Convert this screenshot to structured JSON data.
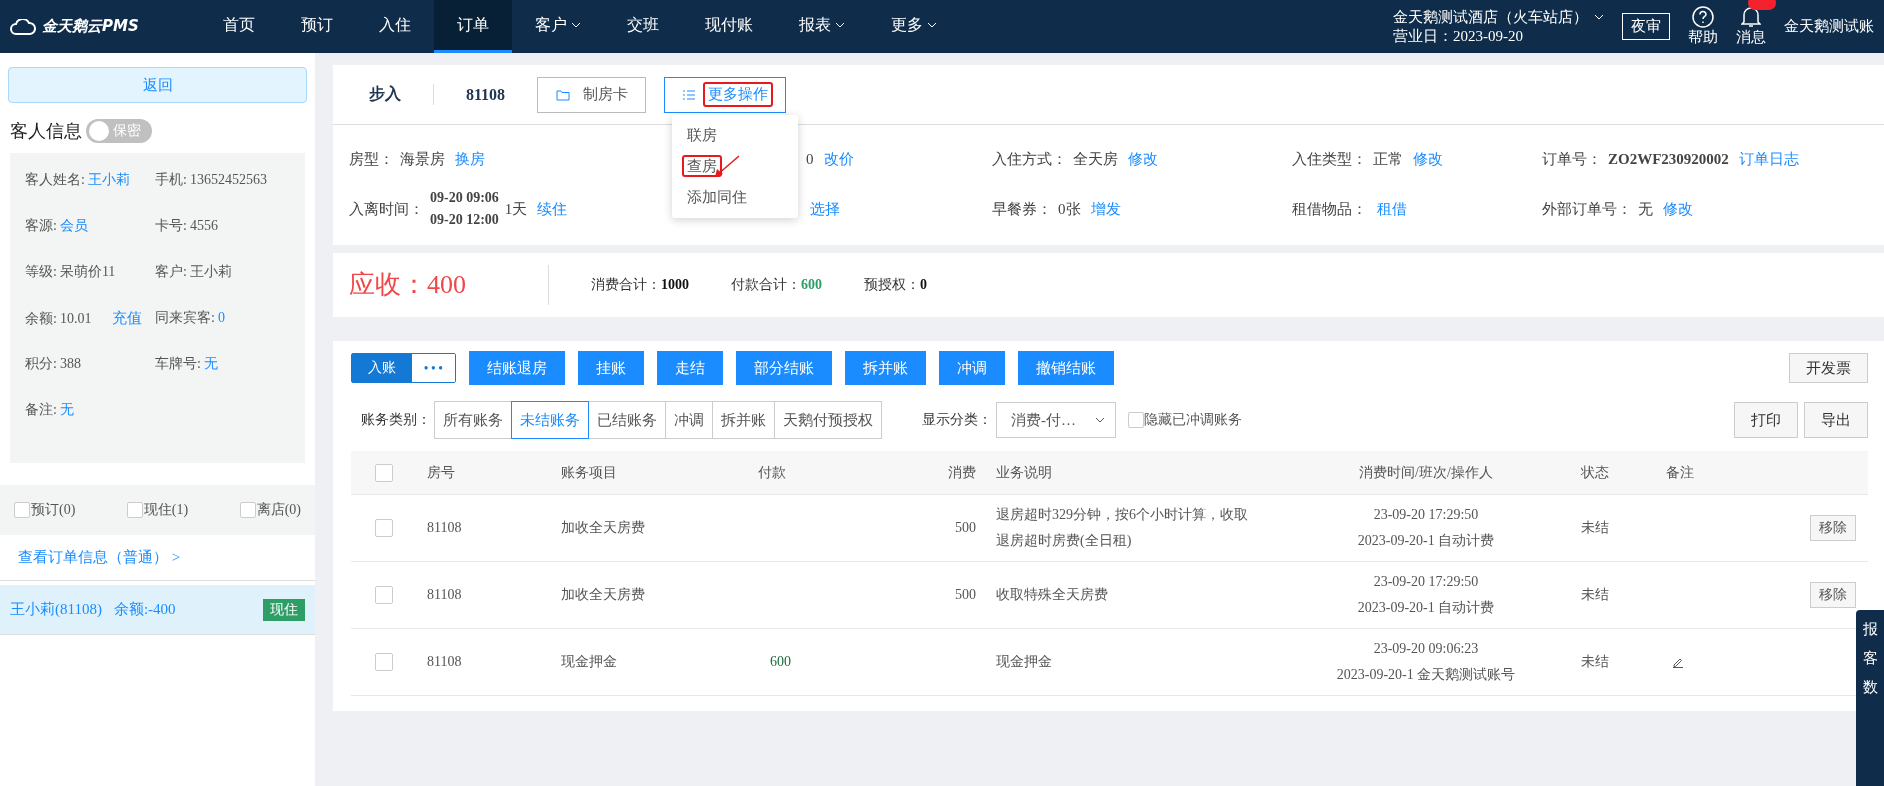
{
  "topbar": {
    "logo": "金天鹅云PMS",
    "nav": [
      {
        "label": "首页",
        "selected": false,
        "caret": false
      },
      {
        "label": "预订",
        "selected": false,
        "caret": false
      },
      {
        "label": "入住",
        "selected": false,
        "caret": false
      },
      {
        "label": "订单",
        "selected": true,
        "caret": false
      },
      {
        "label": "客户",
        "selected": false,
        "caret": true
      },
      {
        "label": "交班",
        "selected": false,
        "caret": false
      },
      {
        "label": "现付账",
        "selected": false,
        "caret": false
      },
      {
        "label": "报表",
        "selected": false,
        "caret": true
      },
      {
        "label": "更多",
        "selected": false,
        "caret": true
      }
    ],
    "hotel": "金天鹅测试酒店（火车站店）",
    "business_day": "营业日：2023-09-20",
    "night_audit": "夜审",
    "help": "帮助",
    "messages": "消息",
    "account": "金天鹅测试账"
  },
  "sidebar": {
    "back": "返回",
    "guest_title": "客人信息",
    "privacy": {
      "label": "保密",
      "on": false
    },
    "guest_fields": [
      {
        "label": "客人姓名:",
        "value": "王小莉",
        "link": true
      },
      {
        "label": "手机:",
        "value": "13652452563",
        "link": false
      },
      {
        "label": "客源:",
        "value": "会员",
        "link": true
      },
      {
        "label": "卡号:",
        "value": "4556",
        "link": false
      },
      {
        "label": "等级:",
        "value": "呆萌价11",
        "link": false
      },
      {
        "label": "客户:",
        "value": "王小莉",
        "link": false
      },
      {
        "label": "余额:",
        "value": "10.01",
        "link": false,
        "action": "充值"
      },
      {
        "label": "同来宾客:",
        "value": "0",
        "link": true
      },
      {
        "label": "积分:",
        "value": "388",
        "link": false
      },
      {
        "label": "车牌号:",
        "value": "无",
        "link": true
      },
      {
        "label": "备注:",
        "value": "无",
        "link": true
      }
    ],
    "filters": [
      {
        "label": "预订(0)",
        "checked": false
      },
      {
        "label": "现住(1)",
        "checked": false
      },
      {
        "label": "离店(0)",
        "checked": false
      }
    ],
    "order_link": "查看订单信息（普通） >",
    "guests": [
      {
        "name": "王小莉(81108)",
        "balance": "余额:-400",
        "status": "现住",
        "selected": true
      }
    ]
  },
  "order": {
    "type": "步入",
    "room": "81108",
    "buttons": [
      {
        "label": "制房卡",
        "highlighted": false
      },
      {
        "label": "更多操作",
        "highlighted": true
      }
    ],
    "menu": [
      {
        "label": "联房",
        "highlighted": false
      },
      {
        "label": "查房",
        "highlighted": true
      },
      {
        "label": "添加同住",
        "highlighted": false
      }
    ],
    "info": [
      {
        "label": "房型：",
        "value": "海景房",
        "action": "换房"
      },
      {
        "value": "0",
        "action": "改价"
      },
      {
        "label": "入住方式：",
        "value": "全天房",
        "action": "修改"
      },
      {
        "label": "入住类型：",
        "value": "正常",
        "action": "修改"
      },
      {
        "label": "订单号：",
        "value": "ZO2WF230920002",
        "bold": true,
        "action": "订单日志"
      },
      {
        "label": "入离时间：",
        "times": [
          "09-20 09:06",
          "09-20 12:00"
        ],
        "value": "1天",
        "action": "续住"
      },
      {
        "action": "选择"
      },
      {
        "label": "早餐券：",
        "value": "0张",
        "action": "增发"
      },
      {
        "label": "租借物品：",
        "action": "租借"
      },
      {
        "label": "外部订单号：",
        "value": "无",
        "action": "修改"
      }
    ]
  },
  "summary": {
    "receivable": "应收：400",
    "items": [
      {
        "label": "消费合计：",
        "value": "1000",
        "kind": "plain"
      },
      {
        "label": "付款合计：",
        "value": "600",
        "kind": "payment"
      },
      {
        "label": "预授权：",
        "value": "0",
        "kind": "plain"
      }
    ]
  },
  "actions": {
    "post": "入账",
    "more": "• • •",
    "buttons": [
      "结账退房",
      "挂账",
      "走结",
      "部分结账",
      "拆并账",
      "冲调",
      "撤销结账"
    ],
    "invoice": "开发票",
    "category_label": "账务类别：",
    "categories": [
      {
        "label": "所有账务",
        "selected": false
      },
      {
        "label": "未结账务",
        "selected": true
      },
      {
        "label": "已结账务",
        "selected": false
      },
      {
        "label": "冲调",
        "selected": false
      },
      {
        "label": "拆并账",
        "selected": false
      },
      {
        "label": "天鹅付预授权",
        "selected": false
      }
    ],
    "display_label": "显示分类：",
    "display_value": "消费-付…",
    "hide_offset": {
      "label": "隐藏已冲调账务",
      "checked": false
    },
    "print": "打印",
    "export": "导出"
  },
  "table": {
    "select_all_checked": false,
    "columns": [
      "房号",
      "账务项目",
      "付款",
      "消费",
      "业务说明",
      "消费时间/班次/操作人",
      "状态",
      "备注"
    ],
    "rows": [
      {
        "checked": false,
        "room": "81108",
        "item": "加收全天房费",
        "payment": "",
        "charge": "500",
        "desc": "退房超时329分钟，按6个小时计算，收取退房超时房费(全日租)",
        "time": "23-09-20 17:29:50",
        "shift": "2023-09-20-1 自动计费",
        "status": "未结",
        "action": "移除"
      },
      {
        "checked": false,
        "room": "81108",
        "item": "加收全天房费",
        "payment": "",
        "charge": "500",
        "desc": "收取特殊全天房费",
        "time": "23-09-20 17:29:50",
        "shift": "2023-09-20-1 自动计费",
        "status": "未结",
        "action": "移除"
      },
      {
        "checked": false,
        "room": "81108",
        "item": "现金押金",
        "payment": "600",
        "charge": "",
        "desc": "现金押金",
        "time": "23-09-20 09:06:23",
        "shift": "2023-09-20-1 金天鹅测试账号",
        "status": "未结"
      }
    ]
  },
  "side_dock": [
    "报",
    "客",
    "数"
  ]
}
